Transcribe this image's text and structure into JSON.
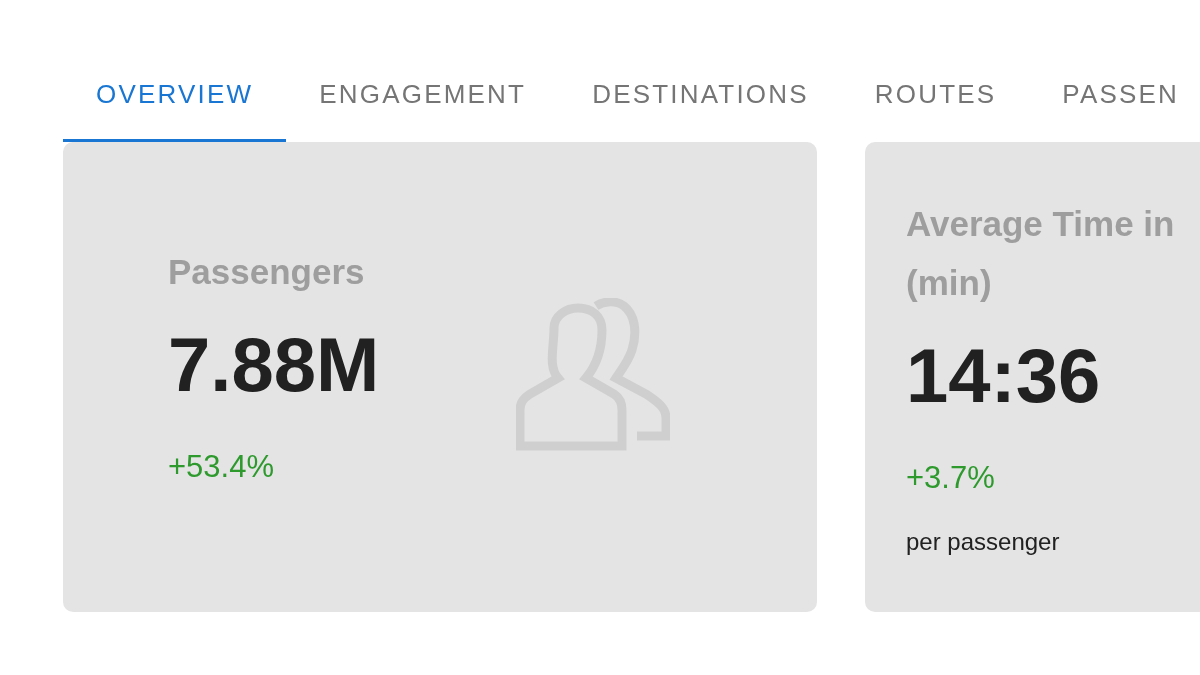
{
  "tabs": [
    {
      "label": "OVERVIEW",
      "selected": true
    },
    {
      "label": "ENGAGEMENT",
      "selected": false
    },
    {
      "label": "DESTINATIONS",
      "selected": false
    },
    {
      "label": "ROUTES",
      "selected": false
    },
    {
      "label": "PASSEN",
      "selected": false
    }
  ],
  "cards": [
    {
      "kind": "pictured",
      "title": "Passengers",
      "value": "7.88M",
      "change": "+53.4%"
    },
    {
      "kind": "plain",
      "title": "Average Time in (min)",
      "value": "14:36",
      "change": "+3.7%",
      "note": "per passenger"
    }
  ]
}
